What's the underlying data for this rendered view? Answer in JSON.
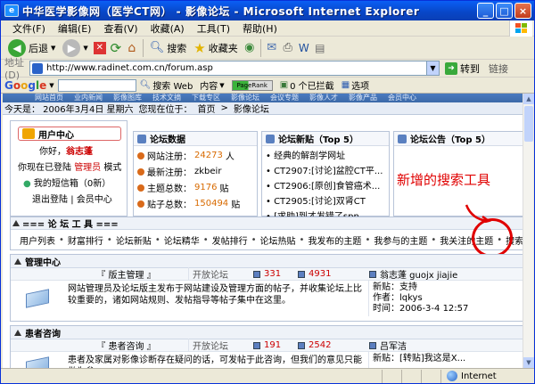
{
  "window": {
    "title": "中华医学影像网（医学CT网） - 影像论坛 - Microsoft Internet Explorer",
    "controls": {
      "minimize": "_",
      "maximize": "□",
      "close": "×"
    }
  },
  "menu": [
    "文件(F)",
    "编辑(E)",
    "查看(V)",
    "收藏(A)",
    "工具(T)",
    "帮助(H)"
  ],
  "toolbar": {
    "back": "后退",
    "search": "搜索",
    "favorites": "收藏夹"
  },
  "address": {
    "label": "地址(D)",
    "url": "http://www.radinet.com.cn/forum.asp",
    "go": "转到",
    "links": "链接"
  },
  "googlebar": {
    "logo": [
      "G",
      "o",
      "o",
      "g",
      "l",
      "e"
    ],
    "search_web": "搜索 Web",
    "content": "内容",
    "pagerank": "PageRank",
    "blocked": "0 个已拦截",
    "options": "选项"
  },
  "site": {
    "topnav": [
      "网站首页",
      "业内新闻",
      "影像图库",
      "技术文摘",
      "下载专区",
      "影像论坛",
      "会议专题",
      "影像人才",
      "影像产品",
      "会员中心"
    ],
    "date": "今天是： 2006年3月4日 星期六",
    "location_label": "您现在位于：",
    "crumb_home": "首页",
    "crumb_arrow": ">",
    "crumb_forum": "影像论坛"
  },
  "user_panel": {
    "title": "用户中心",
    "greeting": "你好，",
    "username": "翁志蓬",
    "login_prefix": "你现在已登陆",
    "role": "管理员",
    "login_suffix": "模式",
    "messages_prefix": "我的短信箱（",
    "messages_count": "0",
    "messages_suffix": "新）",
    "logout": "退出登陆",
    "member_center": "会员中心",
    "separator": "|"
  },
  "stats_panel": {
    "title": "论坛数据",
    "rows": [
      {
        "label": "网站注册：",
        "value": "24273",
        "unit": "人"
      },
      {
        "label": "最新注册：",
        "value": "zkbeir",
        "unit": ""
      },
      {
        "label": "主题总数：",
        "value": "9176",
        "unit": "贴"
      },
      {
        "label": "贴子总数：",
        "value": "150494",
        "unit": "贴"
      }
    ]
  },
  "new_posts_panel": {
    "title": "论坛新贴（Top 5）",
    "items": [
      "经典的解剖学网址",
      "CT2907:[讨论]盆腔CT平...",
      "CT2906:[原创]食管癌术...",
      "CT2905:[讨论]双肾CT",
      "[求助]到才发错了spn"
    ]
  },
  "notice_panel": {
    "title": "论坛公告（Top 5）"
  },
  "annotation": {
    "text": "新增的搜索工具"
  },
  "tools": {
    "title": "=== 论 坛 工 具 ===",
    "links": [
      "用户列表",
      "财富排行",
      "论坛新贴",
      "论坛精华",
      "发帖排行",
      "论坛热贴",
      "我发布的主题",
      "我参与的主题",
      "我关注的主题",
      "搜索"
    ],
    "separator": "•"
  },
  "sections": [
    {
      "title": "管理中心",
      "forum_name": "『 版主管理 』",
      "forum_type": "开放论坛",
      "topics": "331",
      "posts": "4931",
      "moderators": "翁志蓬 guojx jiajie",
      "description": "网站管理员及论坛版主发布于网站建设及管理方面的帖子，并收集论坛上比较重要的，诸如网站规则、发帖指导等帖子集中在这里。",
      "last_post_label": "新贴：",
      "last_post": "支持",
      "author_label": "作者：",
      "author": "lqkys",
      "time_label": "时间：",
      "time": "2006-3-4 12:57"
    },
    {
      "title": "患者咨询",
      "forum_name": "『 患者咨询 』",
      "forum_type": "开放论坛",
      "topics": "191",
      "posts": "2542",
      "moderators": "吕军洁",
      "description": "患者及家属对影像诊断存在疑问的话，可发帖于此咨询，但我们的意见只能做为参",
      "last_post_label": "新贴：",
      "last_post": "[转贴]我这是X..."
    }
  ],
  "status": {
    "zone": "Internet"
  }
}
